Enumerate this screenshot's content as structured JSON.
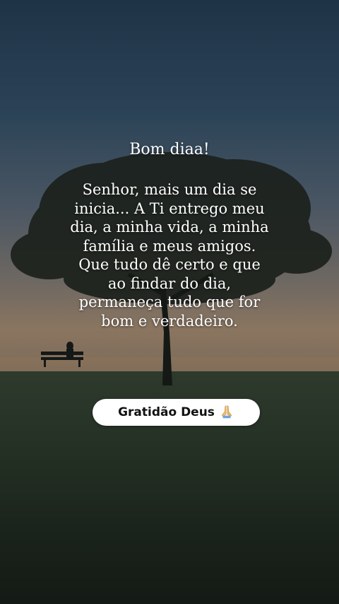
{
  "message": {
    "greeting": "Bom diaa!",
    "lines": [
      "Senhor, mais um dia se",
      "inicia... A Ti entrego meu",
      "dia, a minha vida, a minha",
      "família e meus amigos.",
      "Que tudo dê certo e que",
      "ao findar do dia,",
      "permaneça tudo que for",
      "bom e verdadeiro."
    ]
  },
  "badge": {
    "label": "Gratidão Deus",
    "icon": "praying-hands-icon"
  },
  "colors": {
    "text": "#ffffff",
    "badge_bg": "#ffffff",
    "badge_text": "#111111",
    "sky_top": "#1f3346",
    "ground": "#1a231b"
  }
}
